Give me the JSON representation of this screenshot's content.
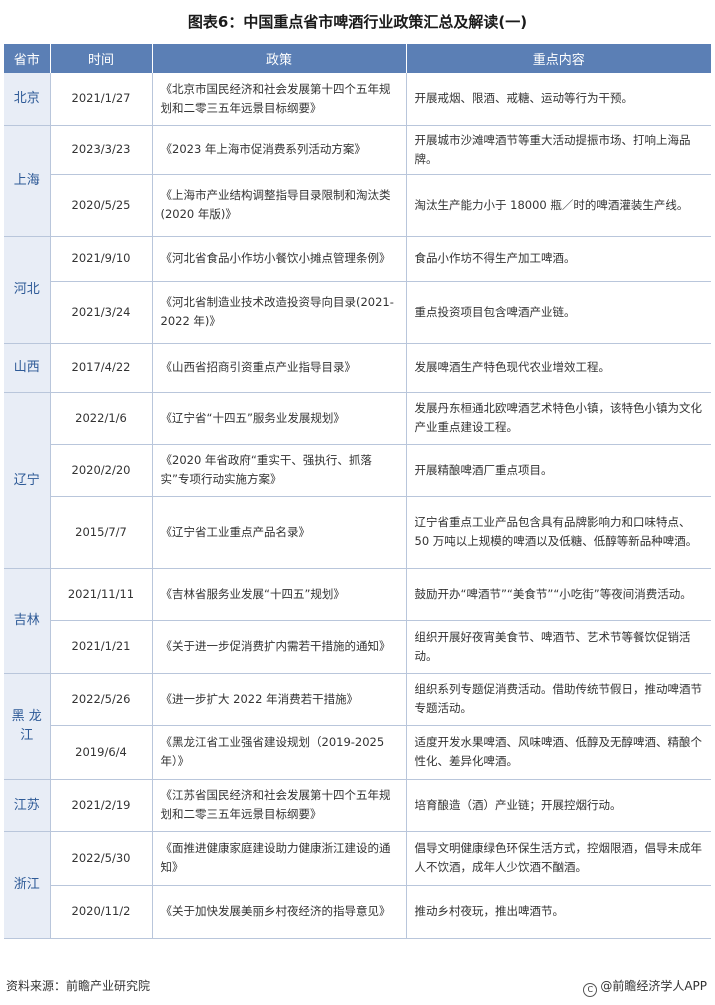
{
  "title": "图表6：中国重点省市啤酒行业政策汇总及解读(一)",
  "headers": [
    "省市",
    "时间",
    "政策",
    "重点内容"
  ],
  "provinces": [
    {
      "name": "北京",
      "rows": [
        {
          "date": "2021/1/27",
          "policy": "《北京市国民经济和社会发展第十四个五年规划和二零三五年远景目标纲要》",
          "content": "开展戒烟、限酒、戒糖、运动等行为干预。"
        }
      ]
    },
    {
      "name": "上海",
      "rows": [
        {
          "date": "2023/3/23",
          "policy": "《2023 年上海市促消费系列活动方案》",
          "content": "开展城市沙滩啤酒节等重大活动提振市场、打响上海品牌。"
        },
        {
          "date": "2020/5/25",
          "policy": "《上海市产业结构调整指导目录限制和淘汰类(2020 年版)》",
          "content": "淘汰生产能力小于 18000 瓶／时的啤酒灌装生产线。"
        }
      ]
    },
    {
      "name": "河北",
      "rows": [
        {
          "date": "2021/9/10",
          "policy": "《河北省食品小作坊小餐饮小摊点管理条例》",
          "content": "食品小作坊不得生产加工啤酒。"
        },
        {
          "date": "2021/3/24",
          "policy": "《河北省制造业技术改造投资导向目录(2021-2022 年)》",
          "content": "重点投资项目包含啤酒产业链。"
        }
      ]
    },
    {
      "name": "山西",
      "rows": [
        {
          "date": "2017/4/22",
          "policy": "《山西省招商引资重点产业指导目录》",
          "content": "发展啤酒生产特色现代农业增效工程。"
        }
      ]
    },
    {
      "name": "辽宁",
      "rows": [
        {
          "date": "2022/1/6",
          "policy": "《辽宁省“十四五”服务业发展规划》",
          "content": "发展丹东桓通北欧啤酒艺术特色小镇，该特色小镇为文化产业重点建设工程。"
        },
        {
          "date": "2020/2/20",
          "policy": "《2020 年省政府“重实干、强执行、抓落实”专项行动实施方案》",
          "content": "开展精酿啤酒厂重点项目。"
        },
        {
          "date": "2015/7/7",
          "policy": "《辽宁省工业重点产品名录》",
          "content": "辽宁省重点工业产品包含具有品牌影响力和口味特点、50 万吨以上规模的啤酒以及低糖、低醇等新品种啤酒。"
        }
      ]
    },
    {
      "name": "吉林",
      "rows": [
        {
          "date": "2021/11/11",
          "policy": "《吉林省服务业发展“十四五”规划》",
          "content": "鼓励开办“啤酒节”“美食节”“小吃街”等夜间消费活动。"
        },
        {
          "date": "2021/1/21",
          "policy": "《关于进一步促消费扩内需若干措施的通知》",
          "content": "组织开展好夜宵美食节、啤酒节、艺术节等餐饮促销活动。"
        }
      ]
    },
    {
      "name": "黑 龙\n江",
      "rows": [
        {
          "date": "2022/5/26",
          "policy": "《进一步扩大 2022 年消费若干措施》",
          "content": "组织系列专题促消费活动。借助传统节假日，推动啤酒节专题活动。"
        },
        {
          "date": "2019/6/4",
          "policy": "《黑龙江省工业强省建设规划（2019-2025 年）》",
          "content": "适度开发水果啤酒、风味啤酒、低醇及无醇啤酒、精酿个性化、差异化啤酒。"
        }
      ]
    },
    {
      "name": "江苏",
      "rows": [
        {
          "date": "2021/2/19",
          "policy": "《江苏省国民经济和社会发展第十四个五年规划和二零三五年远景目标纲要》",
          "content": "培育酿造（酒）产业链；开展控烟行动。"
        }
      ]
    },
    {
      "name": "浙江",
      "rows": [
        {
          "date": "2022/5/30",
          "policy": "《面推进健康家庭建设助力健康浙江建设的通知》",
          "content": "倡导文明健康绿色环保生活方式，控烟限酒，倡导未成年人不饮酒，成年人少饮酒不酗酒。"
        },
        {
          "date": "2020/11/2",
          "policy": "《关于加快发展美丽乡村夜经济的指导意见》",
          "content": "推动乡村夜玩，推出啤酒节。"
        }
      ]
    }
  ],
  "footer": {
    "source": "资料来源：前瞻产业研究院",
    "brand": "@前瞻经济学人APP",
    "brand_icon": "copyright-icon"
  }
}
